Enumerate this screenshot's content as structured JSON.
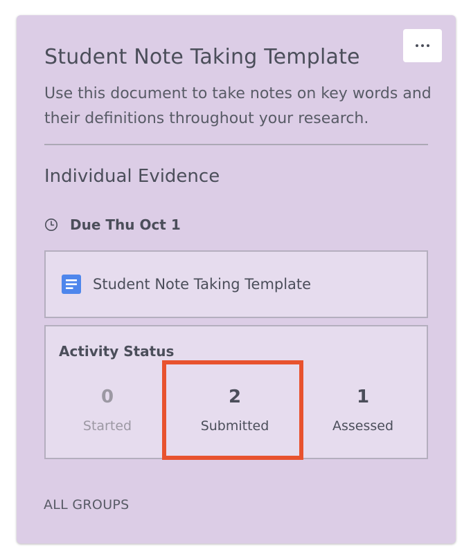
{
  "card": {
    "title": "Student Note Taking Template",
    "description": "Use this document to take notes on key words and their definitions throughout your research.",
    "section_heading": "Individual Evidence",
    "due": "Due Thu Oct 1",
    "document": {
      "label": "Student Note Taking Template",
      "icon": "google-docs-icon"
    },
    "more_menu_icon": "more-horizontal-icon",
    "clock_icon": "clock-icon"
  },
  "activity_status": {
    "heading": "Activity Status",
    "stats": [
      {
        "count": "0",
        "label": "Started"
      },
      {
        "count": "2",
        "label": "Submitted"
      },
      {
        "count": "1",
        "label": "Assessed"
      }
    ]
  },
  "footer": {
    "groups_link": "ALL GROUPS"
  },
  "colors": {
    "card_background": "#dccde6",
    "panel_background": "#e6dcee",
    "panel_border": "#b4aebe",
    "text_primary": "#4b4e5a",
    "text_muted": "#9c98a3",
    "doc_icon_blue": "#4e86ec",
    "highlight": "#e8522e"
  }
}
